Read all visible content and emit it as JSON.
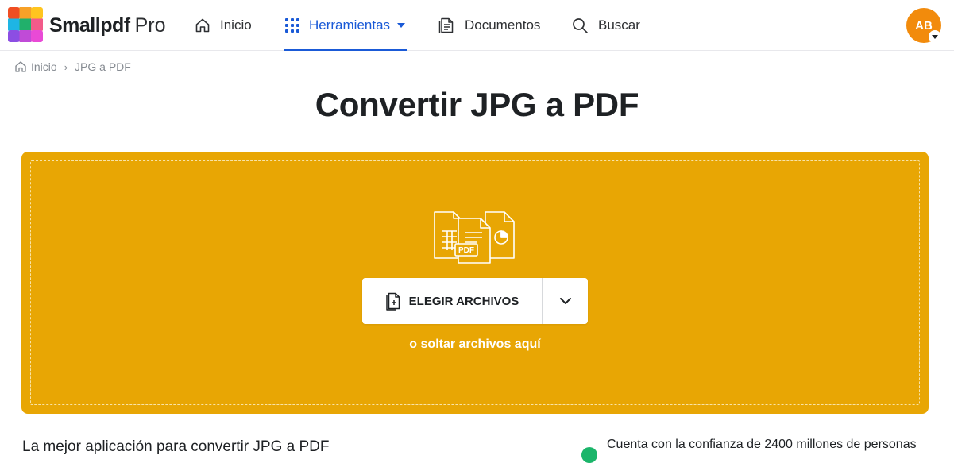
{
  "header": {
    "brand_name": "Smallpdf",
    "brand_tier": "Pro",
    "nav": [
      {
        "label": "Inicio",
        "icon": "home-icon"
      },
      {
        "label": "Herramientas",
        "icon": "grid-icon",
        "active": true
      },
      {
        "label": "Documentos",
        "icon": "documents-icon"
      },
      {
        "label": "Buscar",
        "icon": "search-icon"
      }
    ],
    "avatar_initials": "AB",
    "avatar_color": "#f28b0c",
    "accent_color": "#1a5ad7"
  },
  "breadcrumb": {
    "home": "Inicio",
    "separator": "›",
    "current": "JPG a PDF"
  },
  "main": {
    "title": "Convertir JPG a PDF",
    "dropzone_color": "#e8a604",
    "file_badge": "PDF",
    "choose_button_label": "ELEGIR ARCHIVOS",
    "drop_hint": "o soltar archivos aquí"
  },
  "footer": {
    "tagline": "La mejor aplicación para convertir JPG a PDF",
    "trust": "Cuenta con la confianza de 2400 millones de personas"
  }
}
